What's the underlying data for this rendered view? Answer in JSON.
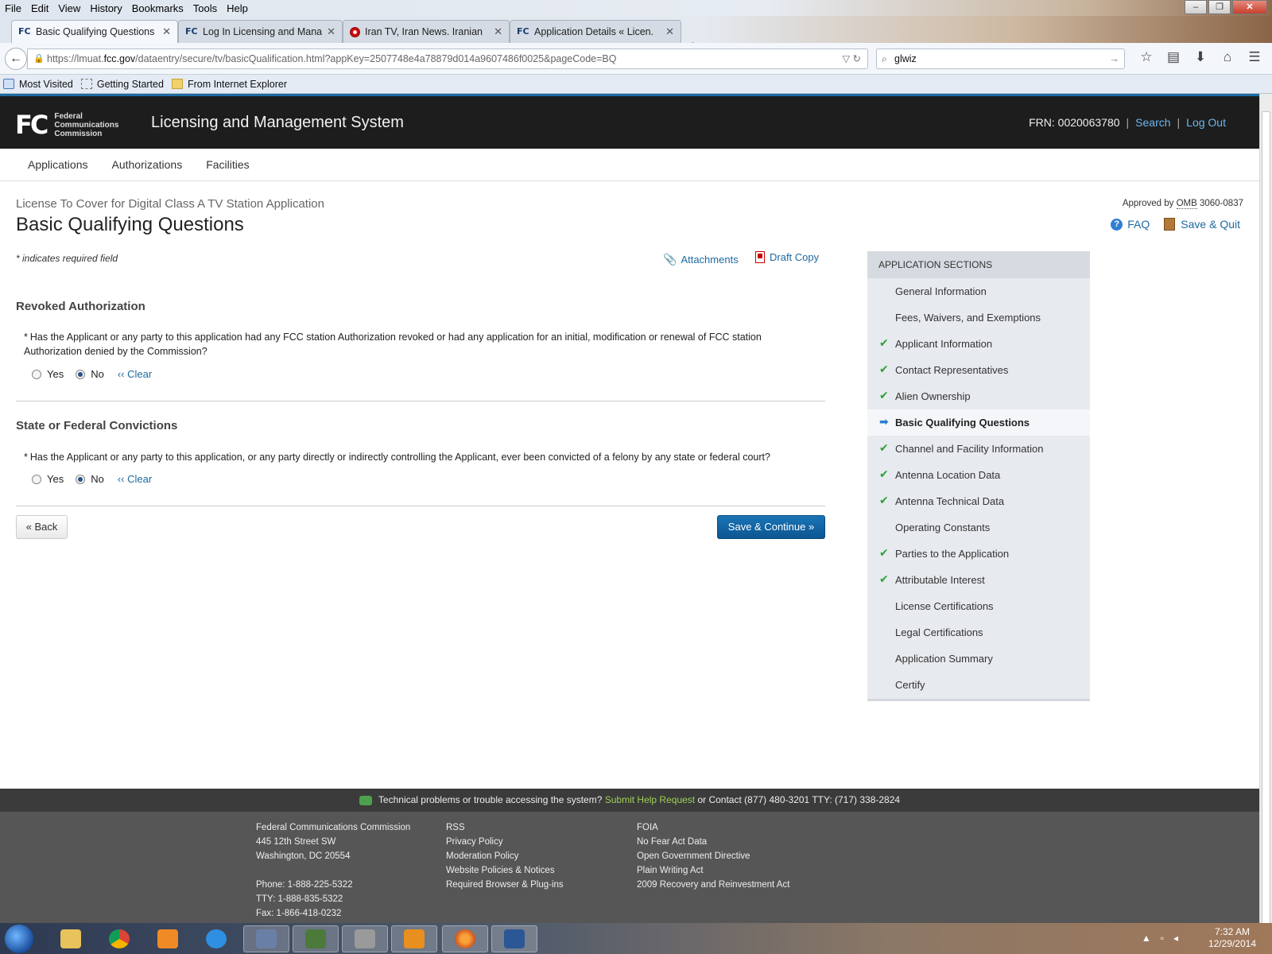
{
  "browser": {
    "menu": [
      "File",
      "Edit",
      "View",
      "History",
      "Bookmarks",
      "Tools",
      "Help"
    ],
    "tabs": [
      {
        "label": "Basic Qualifying Questions...",
        "favicon": "FC"
      },
      {
        "label": "Log In Licensing and Mana...",
        "favicon": "FC"
      },
      {
        "label": "Iran TV, Iran News. Iranian ...",
        "favicon": ""
      },
      {
        "label": "Application Details « Licen...",
        "favicon": "FC"
      }
    ],
    "url_prefix": "https://lmuat.",
    "url_domain": "fcc.gov",
    "url_rest": "/dataentry/secure/tv/basicQualification.html?appKey=2507748e4a78879d014a9607486f0025&pageCode=BQ",
    "search_value": "glwiz",
    "bookmarks": [
      "Most Visited",
      "Getting Started",
      "From Internet Explorer"
    ]
  },
  "header": {
    "logo_words": [
      "Federal",
      "Communications",
      "Commission"
    ],
    "logo_mark": "FC",
    "title": "Licensing and Management System",
    "frn": "FRN: 0020063780",
    "search": "Search",
    "logout": "Log Out"
  },
  "nav": [
    "Applications",
    "Authorizations",
    "Facilities"
  ],
  "page": {
    "breadcrumb": "License To Cover for Digital Class A TV Station Application",
    "title": "Basic Qualifying Questions",
    "omb_prefix": "Approved by ",
    "omb_abbr": "OMB",
    "omb_number": " 3060-0837",
    "faq": "FAQ",
    "save_quit": "Save & Quit",
    "required_note": "* indicates required field",
    "attachments": "Attachments",
    "draft_copy": "Draft Copy"
  },
  "sections": [
    {
      "heading": "Revoked Authorization",
      "question": "Has the Applicant or any party to this application had any FCC station Authorization revoked or had any application for an initial, modification or renewal of FCC station Authorization denied by the Commission?",
      "yes": "Yes",
      "no": "No",
      "clear": "‹‹ Clear",
      "selected": "No"
    },
    {
      "heading": "State or Federal Convictions",
      "question": "Has the Applicant or any party to this application, or any party directly or indirectly controlling the Applicant, ever been convicted of a felony by any state or federal court?",
      "yes": "Yes",
      "no": "No",
      "clear": "‹‹ Clear",
      "selected": "No"
    }
  ],
  "buttons": {
    "back": "« Back",
    "save_continue": "Save & Continue »"
  },
  "sidebar": {
    "heading": "APPLICATION SECTIONS",
    "items": [
      {
        "label": "General Information",
        "status": "none"
      },
      {
        "label": "Fees, Waivers, and Exemptions",
        "status": "none"
      },
      {
        "label": "Applicant Information",
        "status": "complete"
      },
      {
        "label": "Contact Representatives",
        "status": "complete"
      },
      {
        "label": "Alien Ownership",
        "status": "complete"
      },
      {
        "label": "Basic Qualifying Questions",
        "status": "current"
      },
      {
        "label": "Channel and Facility Information",
        "status": "complete"
      },
      {
        "label": "Antenna Location Data",
        "status": "complete"
      },
      {
        "label": "Antenna Technical Data",
        "status": "complete"
      },
      {
        "label": "Operating Constants",
        "status": "none"
      },
      {
        "label": "Parties to the Application",
        "status": "complete"
      },
      {
        "label": "Attributable Interest",
        "status": "complete"
      },
      {
        "label": "License Certifications",
        "status": "none"
      },
      {
        "label": "Legal Certifications",
        "status": "none"
      },
      {
        "label": "Application Summary",
        "status": "none"
      },
      {
        "label": "Certify",
        "status": "none"
      }
    ]
  },
  "footer": {
    "help_prefix": "Technical problems or trouble accessing the system?",
    "help_link": "Submit Help Request",
    "help_suffix": " or Contact (877) 480-3201 TTY: (717) 338-2824",
    "col1": [
      "Federal Communications Commission",
      "445 12th Street SW",
      "Washington, DC 20554",
      "",
      "Phone: 1-888-225-5322",
      "TTY: 1-888-835-5322",
      "Fax: 1-866-418-0232"
    ],
    "col2": [
      "RSS",
      "Privacy Policy",
      "Moderation Policy",
      "Website Policies & Notices",
      "Required Browser & Plug-ins"
    ],
    "col3": [
      "FOIA",
      "No Fear Act Data",
      "Open Government Directive",
      "Plain Writing Act",
      "2009 Recovery and Reinvestment Act"
    ]
  },
  "taskbar": {
    "time": "7:32 AM",
    "date": "12/29/2014"
  },
  "colors": {
    "brand_blue": "#1d6aa1",
    "check_green": "#2ea137",
    "header_dark": "#1d1d1d"
  }
}
